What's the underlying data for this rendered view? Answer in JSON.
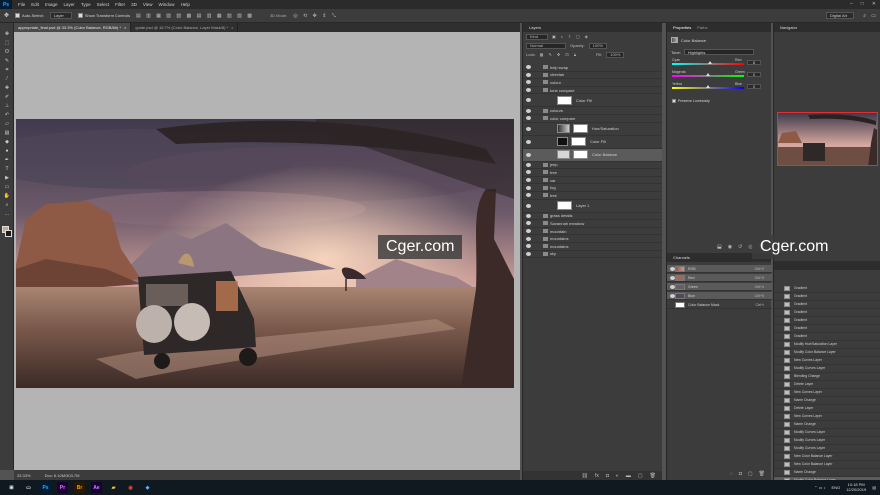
{
  "menubar": {
    "logo": "Ps",
    "items": [
      "File",
      "Edit",
      "Image",
      "Layer",
      "Type",
      "Select",
      "Filter",
      "3D",
      "View",
      "Window",
      "Help"
    ]
  },
  "options": {
    "auto_select_label": "Auto-Select:",
    "auto_select_value": "Layer",
    "show_transform_label": "Show Transform Controls",
    "mode_label": "3D Mode:",
    "workspace": "Digital Art"
  },
  "document_tabs": [
    {
      "label": "appropriate_final.psd @ 33.3% (Color Balance, RGB/8#) *",
      "active": true
    },
    {
      "label": "guide.psd @ 16.7% (Color Balance, Layer Mask/8) *",
      "active": false
    }
  ],
  "status": {
    "zoom": "33.33%",
    "doc": "Doc: 6.10M/303.7M"
  },
  "layers_panel": {
    "title": "Layers",
    "filter_label": "Kind",
    "blend_mode": "Normal",
    "opacity_label": "Opacity:",
    "opacity": "100%",
    "lock_label": "Lock:",
    "fill_label": "Fill:",
    "fill": "100%",
    "layers": [
      {
        "name": "help swap",
        "kind": "group"
      },
      {
        "name": "cheetah",
        "kind": "group"
      },
      {
        "name": "colour",
        "kind": "group"
      },
      {
        "name": "tone compare",
        "kind": "group"
      },
      {
        "name": "Color Fill",
        "kind": "fill"
      },
      {
        "name": "colours",
        "kind": "group"
      },
      {
        "name": "color compare",
        "kind": "group"
      },
      {
        "name": "Hue/Saturation",
        "kind": "adjust"
      },
      {
        "name": "Color Fill",
        "kind": "fillblack"
      },
      {
        "name": "Color Balance",
        "kind": "adjust-selected"
      },
      {
        "name": "jeep",
        "kind": "group"
      },
      {
        "name": "tree",
        "kind": "group"
      },
      {
        "name": "car",
        "kind": "group"
      },
      {
        "name": "fog",
        "kind": "group"
      },
      {
        "name": "tree",
        "kind": "group"
      },
      {
        "name": "Layer 1",
        "kind": "pixel"
      },
      {
        "name": "grass details",
        "kind": "group"
      },
      {
        "name": "Savannah meadow",
        "kind": "group"
      },
      {
        "name": "mountain",
        "kind": "group"
      },
      {
        "name": "mountains",
        "kind": "group"
      },
      {
        "name": "mountains",
        "kind": "group"
      },
      {
        "name": "sky",
        "kind": "group"
      }
    ]
  },
  "properties_panel": {
    "tabs": [
      "Properties",
      "Paths"
    ],
    "adjustment": "Color Balance",
    "tone_label": "Tone:",
    "tone_value": "Highlights",
    "sliders": [
      {
        "left": "Cyan",
        "right": "Red",
        "value": 8,
        "fraction": 0.53,
        "gradient": "linear-gradient(90deg,#00ffff,#ff0000)"
      },
      {
        "left": "Magenta",
        "right": "Green",
        "value": 0,
        "fraction": 0.5,
        "gradient": "linear-gradient(90deg,#ff00ff,#00ff00)"
      },
      {
        "left": "Yellow",
        "right": "Blue",
        "value": 0,
        "fraction": 0.5,
        "gradient": "linear-gradient(90deg,#ffff00,#0000ff)"
      }
    ],
    "preserve_label": "Preserve Luminosity"
  },
  "channels_panel": {
    "title": "Channels",
    "channels": [
      {
        "name": "RGB",
        "shortcut": "Ctrl+2",
        "selected": true
      },
      {
        "name": "Red",
        "shortcut": "Ctrl+3",
        "selected": true
      },
      {
        "name": "Green",
        "shortcut": "Ctrl+4",
        "selected": true
      },
      {
        "name": "Blue",
        "shortcut": "Ctrl+5",
        "selected": true
      },
      {
        "name": "Color Balance Mask",
        "shortcut": "Ctrl+\\",
        "selected": false
      }
    ]
  },
  "navigator_panel": {
    "title": "Navigator"
  },
  "history_panel": {
    "items": [
      "Gradient",
      "Gradient",
      "Gradient",
      "Gradient",
      "Gradient",
      "Gradient",
      "Gradient",
      "Modify Hue/Saturation Layer",
      "Modify Color Balance Layer",
      "New Curves Layer",
      "Modify Curves Layer",
      "Blending Change",
      "Delete Layer",
      "New Curves Layer",
      "Name Change",
      "Delete Layer",
      "New Curves Layer",
      "Name Change",
      "Modify Curves Layer",
      "Modify Curves Layer",
      "Modify Curves Layer",
      "New Color Balance Layer",
      "New Color Balance Layer",
      "Name Change",
      "Modify Color Balance Layer"
    ],
    "selected_index": 24
  },
  "watermarks": [
    "Cger.com",
    "Cger.com"
  ],
  "taskbar": {
    "time": "10:18 PM",
    "date": "12/20/2019",
    "lang": "ENG"
  },
  "colors": {
    "accent": "#31a8ff",
    "panel": "#3c3c3c",
    "canvas_bg": "#b4b4b4"
  }
}
